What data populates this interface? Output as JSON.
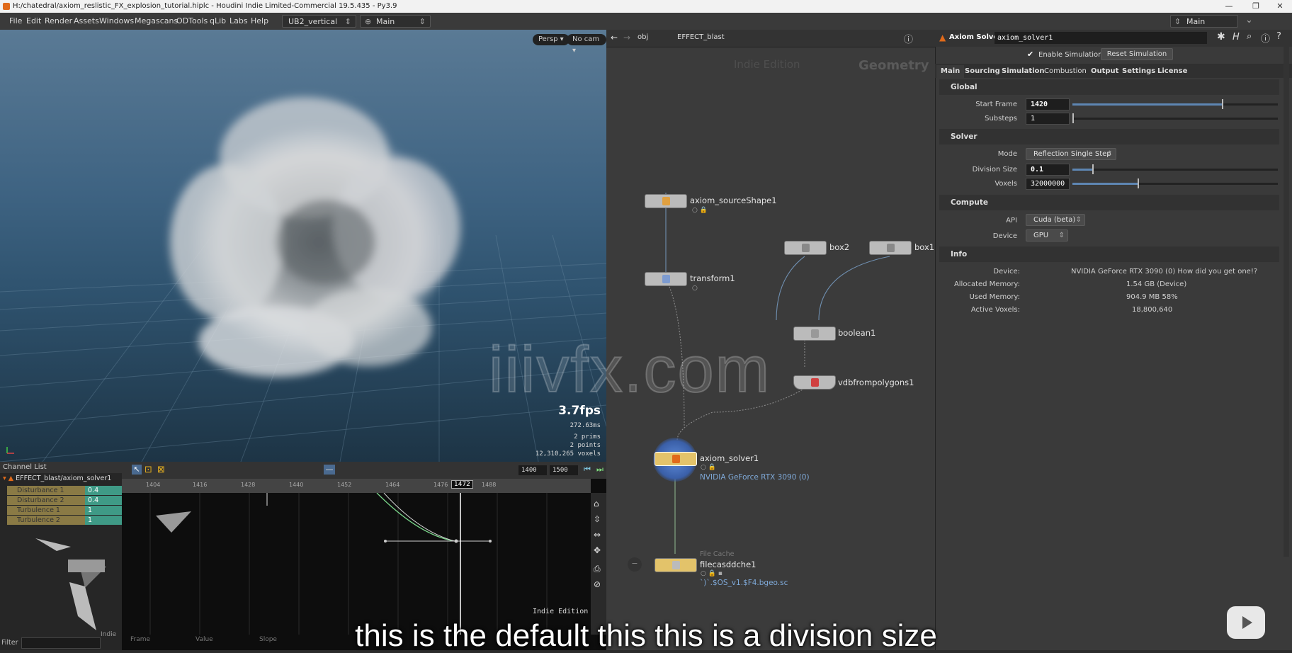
{
  "window": {
    "title": "H:/chatedral/axiom_reslistic_FX_explosion_tutorial.hiplc - Houdini Indie Limited-Commercial 19.5.435 - Py3.9",
    "controls": [
      "—",
      "❐",
      "✕"
    ]
  },
  "menubar": {
    "items": [
      "File",
      "Edit",
      "Render",
      "Assets",
      "Windows",
      "Megascans",
      "ODTools",
      "qLib",
      "Labs",
      "Help"
    ],
    "desktop": "UB2_vertical",
    "context": "Main",
    "right_desktop": "Main"
  },
  "viewport": {
    "persp": "Persp",
    "cam": "No cam",
    "fps": "3.7fps",
    "ms": "272.63ms",
    "prims": "2  prims",
    "points": "2  points",
    "voxels": "12,310,265 voxels"
  },
  "network": {
    "path_obj": "obj",
    "path_node": "EFFECT_blast",
    "edition": "Indie Edition",
    "context_label": "Geometry",
    "nodes": {
      "source": "axiom_sourceShape1",
      "transform": "transform1",
      "box2": "box2",
      "box1": "box1",
      "boolean": "boolean1",
      "vdb": "vdbfrompolygons1",
      "solver": "axiom_solver1",
      "solver_sub": "NVIDIA GeForce RTX 3090 (0)",
      "cache_type": "File Cache",
      "cache": "filecasddche1",
      "cache_path": "`)`.$OS_v1.$F4.bgeo.sc"
    }
  },
  "parms": {
    "node_type": "Axiom Solver",
    "node_name": "axiom_solver1",
    "enable_sim": "Enable Simulation",
    "reset_sim": "Reset Simulation",
    "tabs": [
      "Main",
      "Sourcing",
      "Simulation",
      "Combustion",
      "Output",
      "Settings",
      "License"
    ],
    "global": {
      "title": "Global",
      "start_frame_label": "Start Frame",
      "start_frame": "1420",
      "start_frame_level": 0.73,
      "substeps_label": "Substeps",
      "substeps": "1",
      "substeps_level": 0.0
    },
    "solver": {
      "title": "Solver",
      "mode_label": "Mode",
      "mode": "Reflection Single Step",
      "division_label": "Division Size",
      "division": "0.1",
      "division_level": 0.1,
      "voxels_label": "Voxels",
      "voxels": "32000000",
      "voxels_level": 0.32
    },
    "compute": {
      "title": "Compute",
      "api_label": "API",
      "api": "Cuda (beta)",
      "device_label": "Device",
      "device": "GPU"
    },
    "info": {
      "title": "Info",
      "device_label": "Device:",
      "device": "NVIDIA GeForce RTX 3090 (0)    How did you get one!?",
      "alloc_label": "Allocated Memory:",
      "alloc": "1.54 GB (Device)",
      "used_label": "Used Memory:",
      "used": "904.9 MB   58%",
      "active_label": "Active Voxels:",
      "active": "18,800,640"
    }
  },
  "channels": {
    "header": "Channel List",
    "path": "EFFECT_blast/axiom_solver1",
    "rows": [
      {
        "name": "Disturbance 1",
        "value": "0.4"
      },
      {
        "name": "Disturbance 2",
        "value": "0.4"
      },
      {
        "name": "Turbulence 1",
        "value": "1"
      },
      {
        "name": "Turbulence 2",
        "value": "1"
      }
    ],
    "filter": "Filter",
    "indie": "Indie"
  },
  "graph": {
    "range_start": "1400",
    "range_end": "1500",
    "current_frame": "1472",
    "ticks": [
      "1404",
      "1416",
      "1428",
      "1440",
      "1452",
      "1464",
      "1476",
      "1488"
    ],
    "cols": [
      "Frame",
      "Value",
      "Slope"
    ],
    "edition": "Indie Edition"
  },
  "watermark": "iiivfx.com",
  "subtitle": "this is the default this this is a division size"
}
